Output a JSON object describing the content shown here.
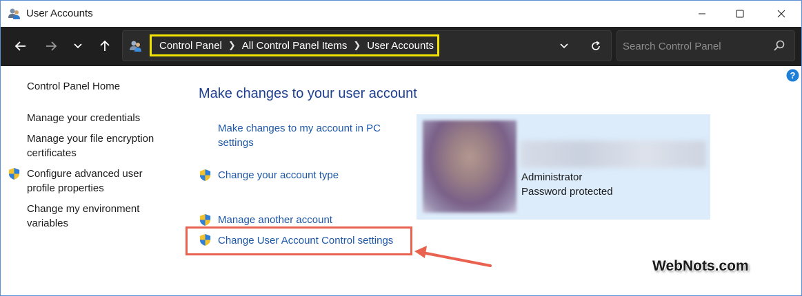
{
  "window": {
    "title": "User Accounts"
  },
  "address_bar": {
    "breadcrumbs": [
      {
        "label": "Control Panel"
      },
      {
        "label": "All Control Panel Items"
      },
      {
        "label": "User Accounts"
      }
    ],
    "highlight_color": "#f2e300"
  },
  "search": {
    "placeholder": "Search Control Panel"
  },
  "sidebar": {
    "home": "Control Panel Home",
    "items": [
      {
        "label": "Manage your credentials",
        "shield": false
      },
      {
        "label": "Manage your file encryption certificates",
        "shield": false
      },
      {
        "label": "Configure advanced user profile properties",
        "shield": true
      },
      {
        "label": "Change my environment variables",
        "shield": false
      }
    ]
  },
  "main": {
    "title": "Make changes to your user account",
    "tasks": [
      {
        "label": "Make changes to my account in PC settings",
        "shield": false
      },
      {
        "label": "Change your account type",
        "shield": true
      },
      {
        "label": "Manage another account",
        "shield": true
      },
      {
        "label": "Change User Account Control settings",
        "shield": true,
        "highlighted": true
      }
    ]
  },
  "account": {
    "role": "Administrator",
    "status": "Password protected"
  },
  "annotation": {
    "highlight_color": "#e8624f",
    "arrow_color": "#e8624f"
  },
  "watermark": "WebNots.com",
  "colors": {
    "link": "#1d57a8",
    "title": "#1e3f8f",
    "navbar": "#1f1f1f",
    "card": "#dcecfb"
  }
}
